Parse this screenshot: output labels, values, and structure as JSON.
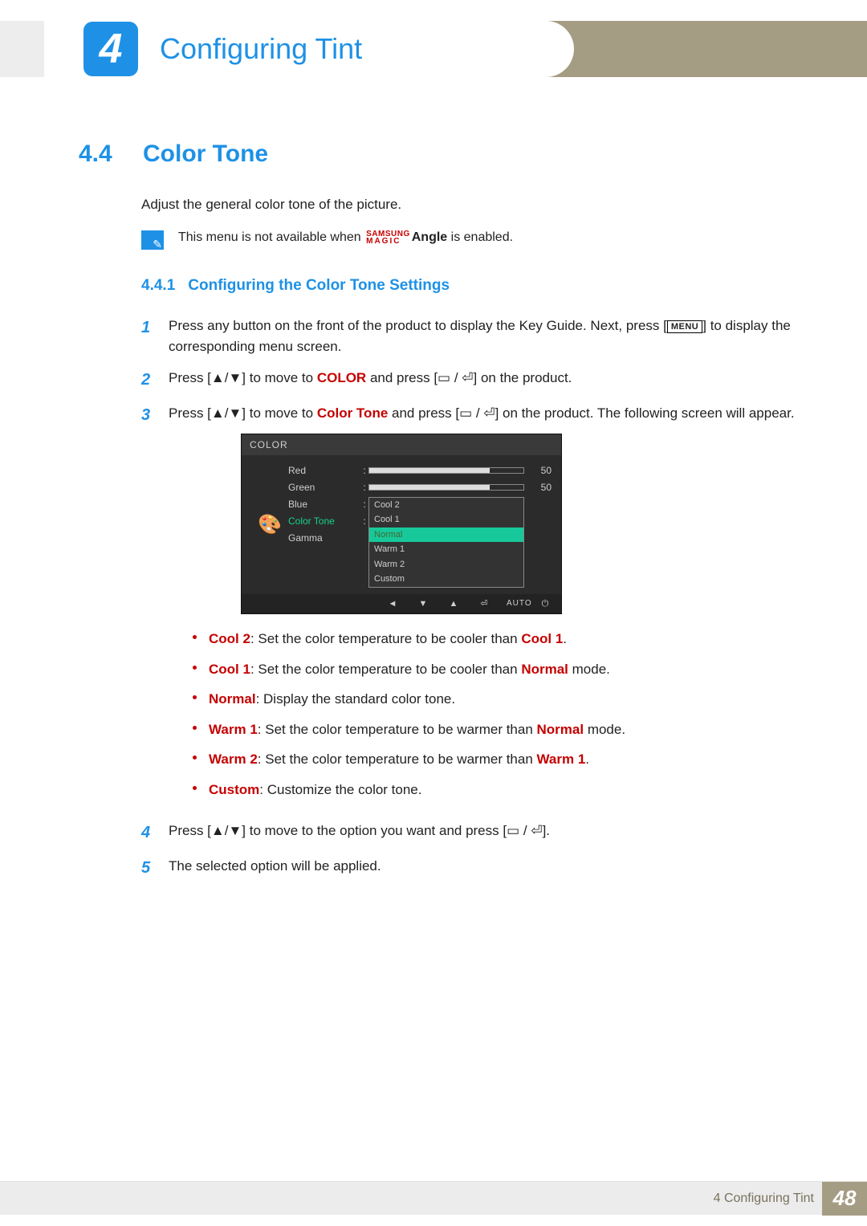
{
  "header": {
    "chapter_number": "4",
    "chapter_title": "Configuring Tint"
  },
  "section": {
    "number": "4.4",
    "title": "Color Tone",
    "intro": "Adjust the general color tone of the picture.",
    "note_prefix": "This menu is not available when ",
    "note_brand_top": "SAMSUNG",
    "note_brand_bottom": "MAGIC",
    "note_brand_word": "Angle",
    "note_suffix": " is enabled."
  },
  "subsection": {
    "number": "4.4.1",
    "title": "Configuring the Color Tone Settings"
  },
  "steps": {
    "s1_a": "Press any button on the front of the product to display the Key Guide. Next, press [",
    "s1_menu": "MENU",
    "s1_b": "] to display the corresponding menu screen.",
    "s2_a": "Press [",
    "arrows": "▲/▼",
    "s2_b": "] to move to ",
    "s2_kw": "COLOR",
    "s2_c": " and press [",
    "enter_glyph": "▭ / ⏎",
    "s2_d": "] on the product.",
    "s3_a": "Press [",
    "s3_b": "] to move to ",
    "s3_kw": "Color Tone",
    "s3_c": " and press [",
    "s3_d": "] on the product. The following screen will appear.",
    "s4_a": "Press [",
    "s4_b": "] to move to the option you want and press [",
    "s4_c": "].",
    "s5": "The selected option will be applied."
  },
  "osd": {
    "title": "COLOR",
    "items": {
      "red": "Red",
      "green": "Green",
      "blue": "Blue",
      "color_tone": "Color Tone",
      "gamma": "Gamma"
    },
    "values": {
      "red": "50",
      "green": "50"
    },
    "options": [
      "Cool 2",
      "Cool 1",
      "Normal",
      "Warm 1",
      "Warm 2",
      "Custom"
    ],
    "selected": "Normal",
    "footer_auto": "AUTO"
  },
  "option_descriptions": [
    {
      "name": "Cool 2",
      "desc_a": ": Set the color temperature to be cooler than ",
      "ref": "Cool 1",
      "desc_b": "."
    },
    {
      "name": "Cool 1",
      "desc_a": ": Set the color temperature to be cooler than ",
      "ref": "Normal",
      "desc_b": " mode."
    },
    {
      "name": "Normal",
      "desc_a": ": Display the standard color tone.",
      "ref": "",
      "desc_b": ""
    },
    {
      "name": "Warm 1",
      "desc_a": ": Set the color temperature to be warmer than ",
      "ref": "Normal",
      "desc_b": " mode."
    },
    {
      "name": "Warm 2",
      "desc_a": ": Set the color temperature to be warmer than ",
      "ref": "Warm 1",
      "desc_b": "."
    },
    {
      "name": "Custom",
      "desc_a": ": Customize the color tone.",
      "ref": "",
      "desc_b": ""
    }
  ],
  "footer": {
    "label": "4 Configuring Tint",
    "page": "48"
  }
}
